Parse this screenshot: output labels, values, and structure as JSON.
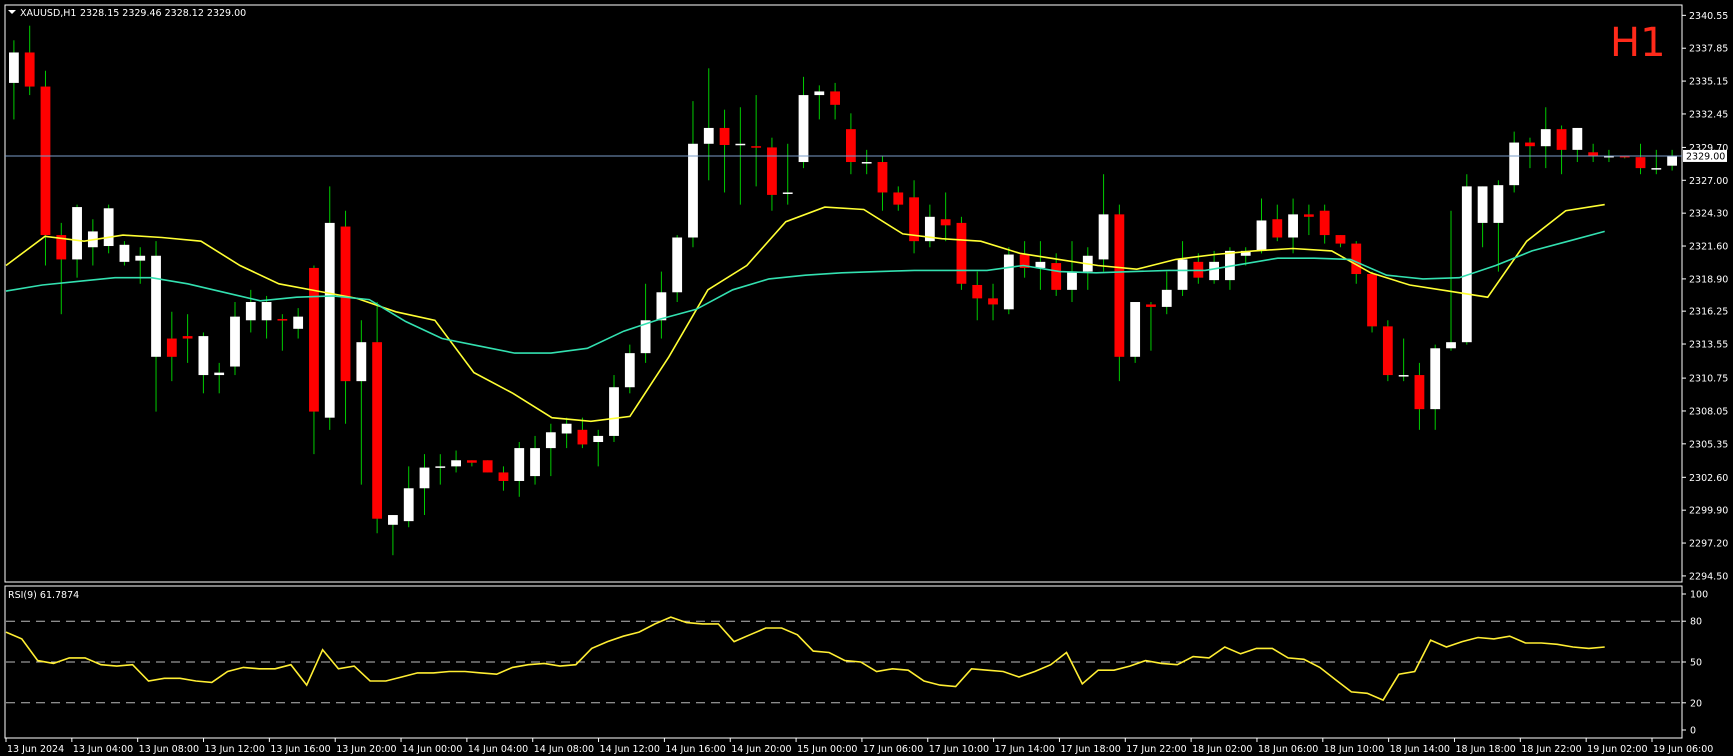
{
  "header": {
    "symbol": "XAUUSD,H1",
    "ohlc": "2328.15 2329.46 2328.12 2329.00",
    "timeframe_badge": "H1"
  },
  "rsi_panel": {
    "label": "RSI(9) 61.7874"
  },
  "colors": {
    "background": "#000000",
    "frame": "#ffffff",
    "bull": "#ffffff",
    "bear": "#ff0000",
    "wick": "#00cc00",
    "ma_fast": "#ffff33",
    "ma_slow": "#33e0b0",
    "rsi": "#ffee33",
    "bid_line": "#7a9cc8",
    "badge": "#ff2a1a"
  },
  "chart_data": [
    {
      "type": "candlestick",
      "title": "XAUUSD,H1",
      "price_ticks": [
        "2340.55",
        "2337.85",
        "2335.15",
        "2332.45",
        "2329.70",
        "2327.00",
        "2324.30",
        "2321.60",
        "2318.90",
        "2316.25",
        "2313.55",
        "2310.75",
        "2308.05",
        "2305.35",
        "2302.60",
        "2299.90",
        "2297.20",
        "2294.50"
      ],
      "ylim": [
        2294.0,
        2341.4
      ],
      "current_price_label": "2329.00",
      "current_price": 2329.0,
      "x_labels": [
        "13 Jun 2024",
        "13 Jun 04:00",
        "13 Jun 08:00",
        "13 Jun 12:00",
        "13 Jun 16:00",
        "13 Jun 20:00",
        "14 Jun 00:00",
        "14 Jun 04:00",
        "14 Jun 08:00",
        "14 Jun 12:00",
        "14 Jun 16:00",
        "14 Jun 20:00",
        "15 Jun 00:00",
        "17 Jun 06:00",
        "17 Jun 10:00",
        "17 Jun 14:00",
        "17 Jun 18:00",
        "17 Jun 22:00",
        "18 Jun 02:00",
        "18 Jun 06:00",
        "18 Jun 10:00",
        "18 Jun 14:00",
        "18 Jun 18:00",
        "18 Jun 22:00",
        "19 Jun 02:00",
        "19 Jun 06:00"
      ],
      "candles": [
        {
          "o": 2335.0,
          "h": 2338.5,
          "l": 2332.0,
          "c": 2337.5
        },
        {
          "o": 2337.5,
          "h": 2339.7,
          "l": 2334.0,
          "c": 2334.7
        },
        {
          "o": 2334.7,
          "h": 2336.0,
          "l": 2320.0,
          "c": 2322.5
        },
        {
          "o": 2322.5,
          "h": 2323.5,
          "l": 2316.0,
          "c": 2320.5
        },
        {
          "o": 2320.5,
          "h": 2325.0,
          "l": 2319.0,
          "c": 2324.8
        },
        {
          "o": 2321.5,
          "h": 2323.8,
          "l": 2320.0,
          "c": 2322.8
        },
        {
          "o": 2321.6,
          "h": 2325.0,
          "l": 2321.0,
          "c": 2324.7
        },
        {
          "o": 2320.3,
          "h": 2322.0,
          "l": 2320.0,
          "c": 2321.7
        },
        {
          "o": 2320.4,
          "h": 2321.5,
          "l": 2318.5,
          "c": 2320.8
        },
        {
          "o": 2312.5,
          "h": 2322.0,
          "l": 2308.0,
          "c": 2320.8
        },
        {
          "o": 2314.0,
          "h": 2316.2,
          "l": 2310.5,
          "c": 2312.5
        },
        {
          "o": 2314.2,
          "h": 2316.0,
          "l": 2312.0,
          "c": 2314.0
        },
        {
          "o": 2311.0,
          "h": 2314.5,
          "l": 2309.5,
          "c": 2314.2
        },
        {
          "o": 2311.0,
          "h": 2312.0,
          "l": 2309.5,
          "c": 2311.2
        },
        {
          "o": 2311.7,
          "h": 2317.0,
          "l": 2311.0,
          "c": 2315.8
        },
        {
          "o": 2315.5,
          "h": 2318.0,
          "l": 2314.5,
          "c": 2317.0
        },
        {
          "o": 2315.5,
          "h": 2317.5,
          "l": 2314.0,
          "c": 2317.0
        },
        {
          "o": 2315.6,
          "h": 2316.0,
          "l": 2313.0,
          "c": 2315.5
        },
        {
          "o": 2314.8,
          "h": 2316.5,
          "l": 2314.0,
          "c": 2315.8
        },
        {
          "o": 2319.8,
          "h": 2320.0,
          "l": 2304.5,
          "c": 2308.0
        },
        {
          "o": 2307.5,
          "h": 2326.5,
          "l": 2306.5,
          "c": 2323.5
        },
        {
          "o": 2323.2,
          "h": 2324.5,
          "l": 2307.0,
          "c": 2310.5
        },
        {
          "o": 2310.5,
          "h": 2315.5,
          "l": 2302.0,
          "c": 2313.7
        },
        {
          "o": 2313.7,
          "h": 2317.0,
          "l": 2298.0,
          "c": 2299.2
        },
        {
          "o": 2298.7,
          "h": 2299.5,
          "l": 2296.2,
          "c": 2299.5
        },
        {
          "o": 2299.0,
          "h": 2303.5,
          "l": 2298.5,
          "c": 2301.7
        },
        {
          "o": 2301.7,
          "h": 2304.5,
          "l": 2299.5,
          "c": 2303.4
        },
        {
          "o": 2303.4,
          "h": 2304.5,
          "l": 2302.0,
          "c": 2303.5
        },
        {
          "o": 2303.5,
          "h": 2304.8,
          "l": 2303.0,
          "c": 2304.0
        },
        {
          "o": 2304.0,
          "h": 2304.0,
          "l": 2303.5,
          "c": 2303.8
        },
        {
          "o": 2304.0,
          "h": 2304.0,
          "l": 2303.0,
          "c": 2303.0
        },
        {
          "o": 2303.0,
          "h": 2303.5,
          "l": 2301.5,
          "c": 2302.3
        },
        {
          "o": 2302.3,
          "h": 2305.5,
          "l": 2301.0,
          "c": 2305.0
        },
        {
          "o": 2302.7,
          "h": 2306.0,
          "l": 2302.0,
          "c": 2305.0
        },
        {
          "o": 2305.0,
          "h": 2307.0,
          "l": 2302.7,
          "c": 2306.3
        },
        {
          "o": 2306.2,
          "h": 2307.5,
          "l": 2305.0,
          "c": 2307.0
        },
        {
          "o": 2306.5,
          "h": 2307.5,
          "l": 2305.0,
          "c": 2305.3
        },
        {
          "o": 2305.5,
          "h": 2306.5,
          "l": 2303.5,
          "c": 2306.0
        },
        {
          "o": 2306.0,
          "h": 2311.0,
          "l": 2305.5,
          "c": 2310.0
        },
        {
          "o": 2310.0,
          "h": 2313.5,
          "l": 2309.5,
          "c": 2312.8
        },
        {
          "o": 2312.8,
          "h": 2318.5,
          "l": 2312.0,
          "c": 2315.5
        },
        {
          "o": 2315.5,
          "h": 2319.5,
          "l": 2314.0,
          "c": 2317.8
        },
        {
          "o": 2317.8,
          "h": 2322.5,
          "l": 2317.0,
          "c": 2322.3
        },
        {
          "o": 2322.3,
          "h": 2333.5,
          "l": 2321.5,
          "c": 2330.0
        },
        {
          "o": 2330.0,
          "h": 2336.2,
          "l": 2327.0,
          "c": 2331.3
        },
        {
          "o": 2331.3,
          "h": 2332.8,
          "l": 2326.0,
          "c": 2329.9
        },
        {
          "o": 2329.9,
          "h": 2333.0,
          "l": 2325.0,
          "c": 2330.0
        },
        {
          "o": 2329.8,
          "h": 2334.0,
          "l": 2326.5,
          "c": 2329.7
        },
        {
          "o": 2329.7,
          "h": 2330.5,
          "l": 2324.5,
          "c": 2325.8
        },
        {
          "o": 2326.0,
          "h": 2330.0,
          "l": 2325.0,
          "c": 2326.0
        },
        {
          "o": 2328.5,
          "h": 2335.5,
          "l": 2328.0,
          "c": 2334.0
        },
        {
          "o": 2334.0,
          "h": 2334.8,
          "l": 2332.0,
          "c": 2334.3
        },
        {
          "o": 2334.3,
          "h": 2335.0,
          "l": 2332.0,
          "c": 2333.2
        },
        {
          "o": 2331.2,
          "h": 2332.5,
          "l": 2327.5,
          "c": 2328.5
        },
        {
          "o": 2328.5,
          "h": 2329.5,
          "l": 2327.5,
          "c": 2328.5
        },
        {
          "o": 2328.5,
          "h": 2329.0,
          "l": 2324.5,
          "c": 2326.0
        },
        {
          "o": 2326.0,
          "h": 2326.5,
          "l": 2324.5,
          "c": 2325.0
        },
        {
          "o": 2325.6,
          "h": 2327.0,
          "l": 2321.0,
          "c": 2322.0
        },
        {
          "o": 2322.0,
          "h": 2325.0,
          "l": 2321.5,
          "c": 2324.0
        },
        {
          "o": 2323.8,
          "h": 2326.0,
          "l": 2322.0,
          "c": 2323.3
        },
        {
          "o": 2323.5,
          "h": 2324.0,
          "l": 2318.0,
          "c": 2318.5
        },
        {
          "o": 2318.4,
          "h": 2319.5,
          "l": 2315.5,
          "c": 2317.3
        },
        {
          "o": 2317.3,
          "h": 2318.5,
          "l": 2315.5,
          "c": 2316.8
        },
        {
          "o": 2316.4,
          "h": 2321.5,
          "l": 2316.0,
          "c": 2320.9
        },
        {
          "o": 2320.9,
          "h": 2322.0,
          "l": 2319.0,
          "c": 2319.8
        },
        {
          "o": 2319.8,
          "h": 2322.0,
          "l": 2318.0,
          "c": 2320.3
        },
        {
          "o": 2320.2,
          "h": 2321.0,
          "l": 2317.5,
          "c": 2318.0
        },
        {
          "o": 2318.0,
          "h": 2322.0,
          "l": 2317.0,
          "c": 2319.5
        },
        {
          "o": 2319.5,
          "h": 2321.5,
          "l": 2318.0,
          "c": 2320.8
        },
        {
          "o": 2320.5,
          "h": 2327.5,
          "l": 2319.5,
          "c": 2324.2
        },
        {
          "o": 2324.2,
          "h": 2325.0,
          "l": 2310.5,
          "c": 2312.5
        },
        {
          "o": 2312.5,
          "h": 2317.0,
          "l": 2312.0,
          "c": 2317.0
        },
        {
          "o": 2316.8,
          "h": 2317.0,
          "l": 2313.0,
          "c": 2316.6
        },
        {
          "o": 2316.6,
          "h": 2319.5,
          "l": 2316.0,
          "c": 2318.0
        },
        {
          "o": 2318.0,
          "h": 2322.0,
          "l": 2317.5,
          "c": 2320.5
        },
        {
          "o": 2320.3,
          "h": 2321.0,
          "l": 2318.5,
          "c": 2319.0
        },
        {
          "o": 2318.8,
          "h": 2321.2,
          "l": 2318.5,
          "c": 2320.3
        },
        {
          "o": 2318.8,
          "h": 2321.5,
          "l": 2318.0,
          "c": 2321.2
        },
        {
          "o": 2320.8,
          "h": 2321.5,
          "l": 2320.0,
          "c": 2321.2
        },
        {
          "o": 2321.2,
          "h": 2325.5,
          "l": 2321.0,
          "c": 2323.7
        },
        {
          "o": 2323.8,
          "h": 2325.0,
          "l": 2322.0,
          "c": 2322.3
        },
        {
          "o": 2322.3,
          "h": 2325.5,
          "l": 2321.0,
          "c": 2324.2
        },
        {
          "o": 2324.2,
          "h": 2325.0,
          "l": 2322.5,
          "c": 2324.0
        },
        {
          "o": 2324.5,
          "h": 2325.0,
          "l": 2321.8,
          "c": 2322.5
        },
        {
          "o": 2322.5,
          "h": 2322.5,
          "l": 2321.5,
          "c": 2321.8
        },
        {
          "o": 2321.8,
          "h": 2322.0,
          "l": 2318.5,
          "c": 2319.3
        },
        {
          "o": 2319.3,
          "h": 2319.5,
          "l": 2314.5,
          "c": 2315.0
        },
        {
          "o": 2315.0,
          "h": 2315.5,
          "l": 2310.5,
          "c": 2311.0
        },
        {
          "o": 2311.0,
          "h": 2314.0,
          "l": 2310.5,
          "c": 2311.0
        },
        {
          "o": 2311.0,
          "h": 2312.0,
          "l": 2306.5,
          "c": 2308.2
        },
        {
          "o": 2308.2,
          "h": 2313.5,
          "l": 2306.5,
          "c": 2313.2
        },
        {
          "o": 2313.2,
          "h": 2324.5,
          "l": 2313.0,
          "c": 2313.7
        },
        {
          "o": 2313.7,
          "h": 2327.5,
          "l": 2313.5,
          "c": 2326.5
        },
        {
          "o": 2323.5,
          "h": 2326.5,
          "l": 2321.5,
          "c": 2326.5
        },
        {
          "o": 2323.5,
          "h": 2327.0,
          "l": 2319.5,
          "c": 2326.6
        },
        {
          "o": 2326.6,
          "h": 2331.0,
          "l": 2326.0,
          "c": 2330.1
        },
        {
          "o": 2330.1,
          "h": 2330.5,
          "l": 2328.0,
          "c": 2329.8
        },
        {
          "o": 2329.8,
          "h": 2333.0,
          "l": 2328.0,
          "c": 2331.2
        },
        {
          "o": 2331.2,
          "h": 2331.5,
          "l": 2327.5,
          "c": 2329.5
        },
        {
          "o": 2329.5,
          "h": 2331.3,
          "l": 2328.5,
          "c": 2331.3
        },
        {
          "o": 2329.3,
          "h": 2330.0,
          "l": 2328.5,
          "c": 2329.0
        },
        {
          "o": 2329.0,
          "h": 2329.5,
          "l": 2328.5,
          "c": 2329.0
        },
        {
          "o": 2329.0,
          "h": 2329.0,
          "l": 2328.8,
          "c": 2328.9
        },
        {
          "o": 2328.9,
          "h": 2330.0,
          "l": 2327.5,
          "c": 2328.0
        },
        {
          "o": 2328.0,
          "h": 2329.5,
          "l": 2327.5,
          "c": 2328.0
        },
        {
          "o": 2328.2,
          "h": 2329.5,
          "l": 2327.8,
          "c": 2329.0
        }
      ],
      "ma_fast": [
        2320.0,
        2322.4,
        2322.0,
        2322.5,
        2322.3,
        2322.0,
        2320.0,
        2318.5,
        2317.9,
        2317.3,
        2316.2,
        2315.5,
        2311.2,
        2309.5,
        2307.5,
        2307.2,
        2307.6,
        2312.5,
        2318.0,
        2320.0,
        2323.6,
        2324.8,
        2324.6,
        2322.6,
        2322.2,
        2322.0,
        2321.0,
        2320.5,
        2320.0,
        2319.7,
        2320.5,
        2320.9,
        2321.2,
        2321.4,
        2321.2,
        2319.4,
        2318.4,
        2317.9,
        2317.4,
        2322.0,
        2324.5,
        2325.0
      ],
      "ma_slow": [
        2317.9,
        2318.4,
        2318.7,
        2319.0,
        2319.0,
        2318.5,
        2317.8,
        2317.1,
        2317.4,
        2317.5,
        2317.2,
        2315.4,
        2314.0,
        2313.4,
        2312.8,
        2312.8,
        2313.2,
        2314.6,
        2315.6,
        2316.4,
        2318.0,
        2318.9,
        2319.2,
        2319.4,
        2319.5,
        2319.6,
        2319.6,
        2319.6,
        2320.0,
        2319.5,
        2319.4,
        2319.5,
        2319.6,
        2319.6,
        2320.1,
        2320.6,
        2320.6,
        2320.5,
        2319.2,
        2318.9,
        2319.0,
        2320.0,
        2321.2,
        2322.0,
        2322.8
      ]
    },
    {
      "type": "line",
      "title": "RSI(9) 61.7874",
      "ylim": [
        0,
        100
      ],
      "ticks": [
        "100",
        "80",
        "50",
        "20",
        "0"
      ],
      "levels": [
        80,
        50,
        20
      ],
      "values": [
        72,
        67,
        51,
        49,
        53,
        53,
        48,
        47,
        48,
        36,
        38,
        38,
        36,
        35,
        43,
        46,
        45,
        45,
        48,
        33,
        59,
        45,
        47,
        36,
        36,
        39,
        42,
        42,
        43,
        43,
        42,
        41,
        46,
        48,
        49,
        47,
        48,
        60,
        65,
        69,
        72,
        78,
        83,
        79,
        78,
        78,
        65,
        70,
        75,
        75,
        70,
        58,
        57,
        51,
        50,
        43,
        45,
        44,
        36,
        33,
        32,
        45,
        44,
        43,
        39,
        43,
        48,
        57,
        34,
        44,
        44,
        47,
        51,
        49,
        48,
        54,
        53,
        61,
        56,
        60,
        60,
        53,
        52,
        46,
        37,
        28,
        27,
        22,
        41,
        43,
        66,
        61,
        65,
        68,
        67,
        69,
        64,
        64,
        63,
        61,
        60,
        61
      ]
    }
  ]
}
